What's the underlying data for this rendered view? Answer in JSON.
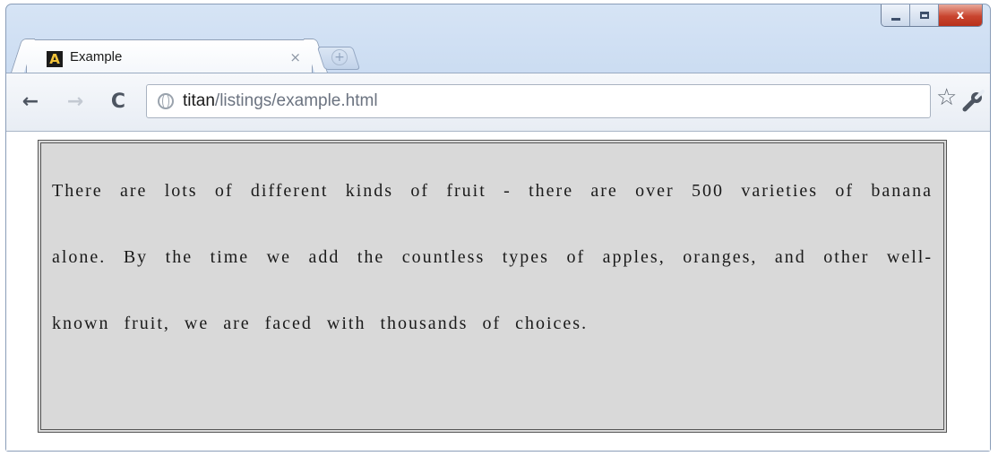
{
  "window": {
    "controls": {
      "minimize": "minimize",
      "maximize": "maximize",
      "close": "x"
    }
  },
  "tab": {
    "title": "Example",
    "favicon_letter": "A",
    "close_glyph": "×"
  },
  "toolbar": {
    "back_glyph": "←",
    "forward_glyph": "→",
    "reload_glyph": "C",
    "url_host": "titan",
    "url_path": "/listings/example.html",
    "star_glyph": "☆"
  },
  "content": {
    "paragraph": "There are lots of different kinds of fruit - there are over 500 varieties of banana alone. By the time we add the countless types of apples, oranges, and other well-known fruit, we are faced with thousands of choices."
  },
  "colors": {
    "paragraph_background": "#d9d9d9",
    "paragraph_border": "#555555",
    "close_button": "#c9452f"
  },
  "icons": [
    "app-favicon-icon",
    "tab-close-icon",
    "new-tab-icon",
    "back-arrow-icon",
    "forward-arrow-icon",
    "reload-icon",
    "globe-icon",
    "star-icon",
    "wrench-icon",
    "minimize-icon",
    "maximize-icon",
    "close-icon"
  ]
}
